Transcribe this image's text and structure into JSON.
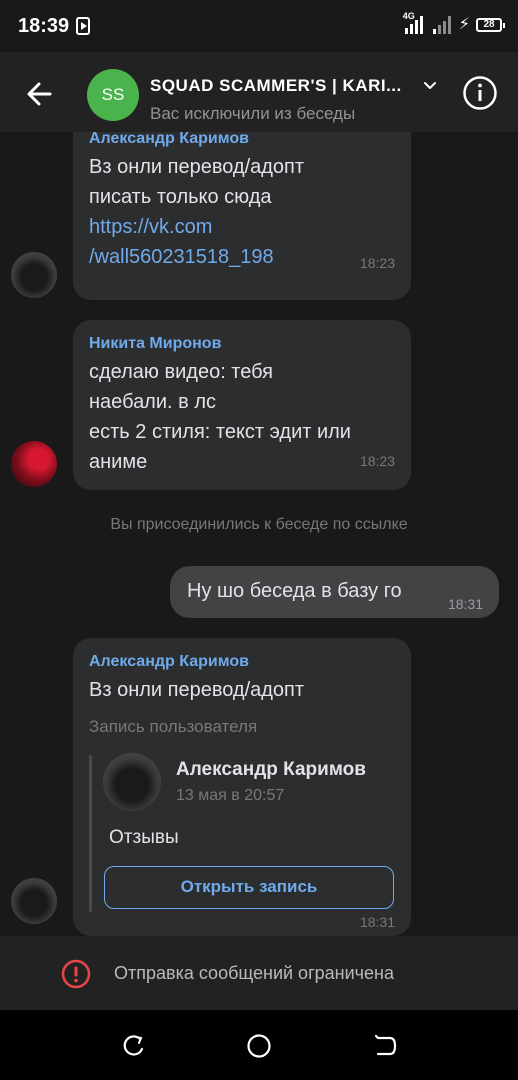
{
  "status_bar": {
    "time": "18:39",
    "network": "4G",
    "battery": "28"
  },
  "header": {
    "avatar_initials": "SS",
    "title": "SQUAD SCAMMER'S | KARI...",
    "subtitle": "Вас исключили из беседы"
  },
  "messages": [
    {
      "sender": "Александр Каримов",
      "lines": [
        "Вз онли перевод/адопт",
        "писать только сюда"
      ],
      "link_lines": [
        "https://vk.com",
        "/wall560231518_198"
      ],
      "time": "18:23"
    },
    {
      "sender": "Никита Миронов",
      "lines": [
        "сделаю видео: тебя",
        "наебали. в лс",
        "есть 2 стиля: текст эдит или",
        "аниме"
      ],
      "time": "18:23"
    }
  ],
  "system_message": "Вы присоединились к беседе по ссылке",
  "my_message": {
    "text": "Ну шо беседа в базу го",
    "time": "18:31"
  },
  "repost_message": {
    "sender": "Александр Каримов",
    "text": "Вз онли перевод/адопт",
    "post_label": "Запись пользователя",
    "post": {
      "author": "Александр Каримов",
      "date": "13 мая в 20:57",
      "text": "Отзывы",
      "button": "Открыть запись"
    },
    "time": "18:31"
  },
  "restriction": "Отправка сообщений ограничена",
  "colors": {
    "background": "#19191a",
    "bubble": "#2c2d2e",
    "accent": "#71aaeb",
    "avatar_green": "#4bb34b",
    "warning": "#e64646"
  }
}
